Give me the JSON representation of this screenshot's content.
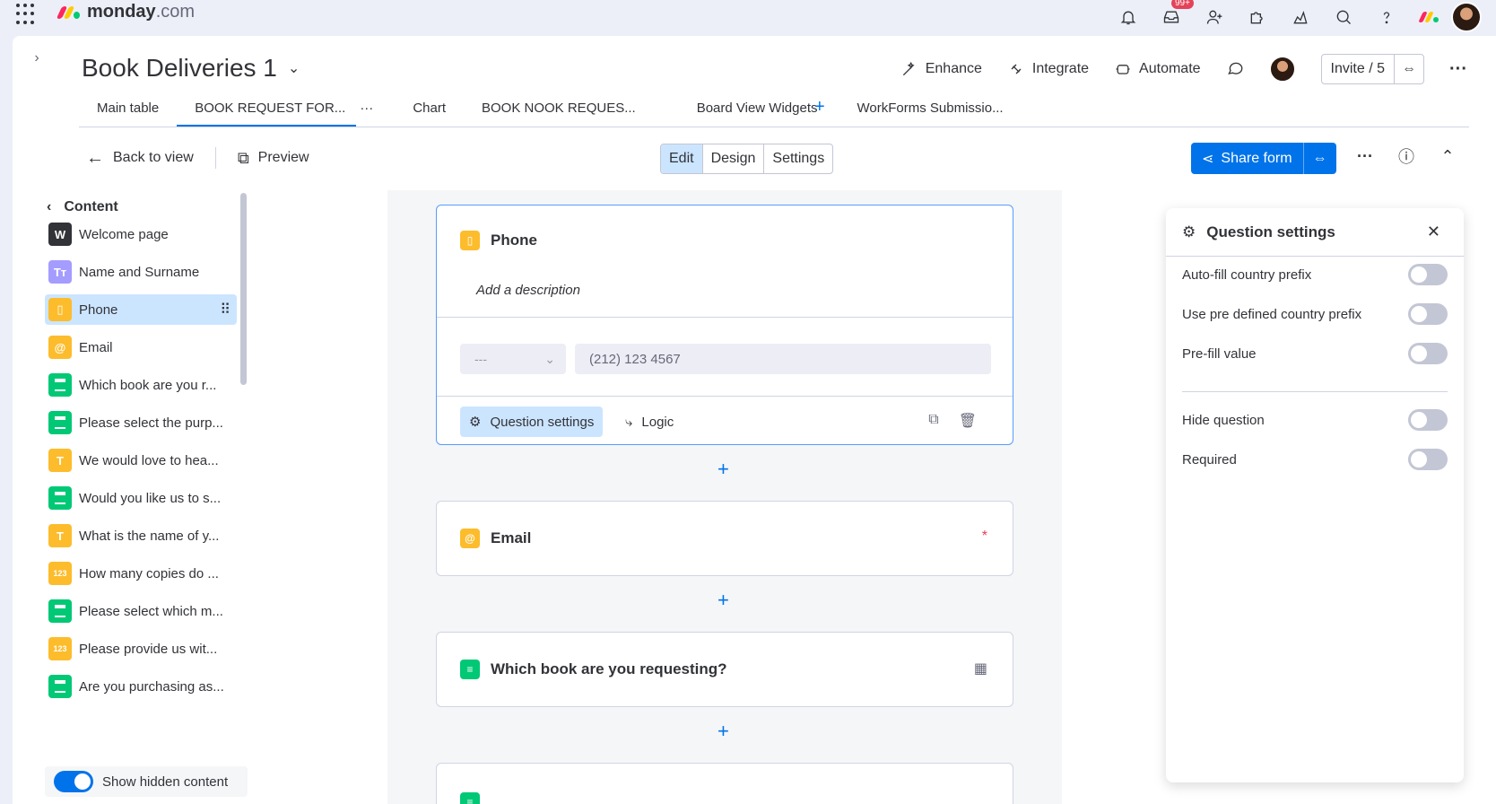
{
  "app": {
    "logo_word": "monday",
    "logo_suffix": ".com",
    "notif_badge": "99+",
    "brand_colors": [
      "#fb275d",
      "#ffcb00",
      "#00ca72"
    ]
  },
  "board": {
    "title": "Book Deliveries 1",
    "actions": [
      "Enhance",
      "Integrate",
      "Automate"
    ],
    "invite_label": "Invite / 5"
  },
  "tabs": [
    {
      "label": "Main table"
    },
    {
      "label": "BOOK REQUEST FOR..."
    },
    {
      "label": "···"
    },
    {
      "label": "Chart"
    },
    {
      "label": "BOOK NOOK REQUES..."
    },
    {
      "label": "Board View Widgets"
    },
    {
      "label": "WorkForms Submissio..."
    },
    {
      "label": "+"
    }
  ],
  "toolbar": {
    "back": "Back to view",
    "preview": "Preview",
    "modes": [
      "Edit",
      "Design",
      "Settings"
    ],
    "share": "Share form"
  },
  "sidebar": {
    "heading": "Content",
    "items": [
      {
        "label": "Welcome page",
        "icon": "W"
      },
      {
        "label": "Name and Surname",
        "icon": "Tт"
      },
      {
        "label": "Phone",
        "icon": "▯"
      },
      {
        "label": "Email",
        "icon": "@"
      },
      {
        "label": "Which book are you r...",
        "icon": ""
      },
      {
        "label": "Please select the purp...",
        "icon": ""
      },
      {
        "label": "We would love to hea...",
        "icon": "T"
      },
      {
        "label": "Would you like us to s...",
        "icon": ""
      },
      {
        "label": "What is the name of y...",
        "icon": "T"
      },
      {
        "label": "How many copies do ...",
        "icon": "123"
      },
      {
        "label": "Please select which m...",
        "icon": ""
      },
      {
        "label": "Please provide us wit...",
        "icon": "123"
      },
      {
        "label": "Are you purchasing as...",
        "icon": ""
      }
    ],
    "show_hidden": "Show hidden content"
  },
  "form": {
    "phone": {
      "title": "Phone",
      "description": "Add a description",
      "country_value": "---",
      "phone_placeholder": "(212) 123 4567",
      "settings_btn": "Question settings",
      "logic_btn": "Logic"
    },
    "email": {
      "title": "Email",
      "required_mark": "*"
    },
    "book": {
      "title": "Which book are you requesting?"
    }
  },
  "question_settings": {
    "title": "Question settings",
    "options": [
      {
        "label": "Auto-fill country prefix",
        "on": false
      },
      {
        "label": "Use pre defined country prefix",
        "on": false
      },
      {
        "label": "Pre-fill value",
        "on": false
      },
      {
        "label": "Hide question",
        "on": false
      },
      {
        "label": "Required",
        "on": false
      }
    ]
  }
}
